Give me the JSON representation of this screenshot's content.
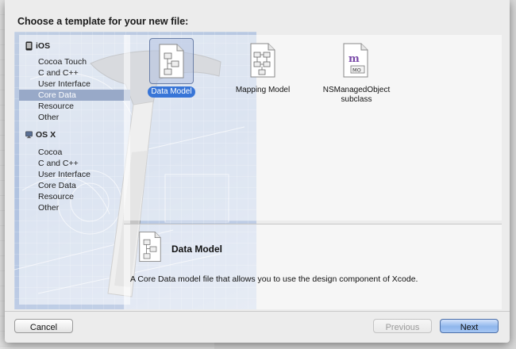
{
  "dialog": {
    "title": "Choose a template for your new file:"
  },
  "sidebar": {
    "sections": [
      {
        "name": "iOS",
        "icon": "iphone-icon",
        "items": [
          "Cocoa Touch",
          "C and C++",
          "User Interface",
          "Core Data",
          "Resource",
          "Other"
        ]
      },
      {
        "name": "OS X",
        "icon": "mac-icon",
        "items": [
          "Cocoa",
          "C and C++",
          "User Interface",
          "Core Data",
          "Resource",
          "Other"
        ]
      }
    ],
    "selected": "iOS / Core Data"
  },
  "templates": [
    {
      "label": "Data Model",
      "icon": "data-model-icon",
      "selected": true
    },
    {
      "label": "Mapping Model",
      "icon": "mapping-model-icon",
      "selected": false
    },
    {
      "label": "NSManagedObject subclass",
      "icon": "managed-object-icon",
      "selected": false
    }
  ],
  "detail": {
    "title": "Data Model",
    "description": "A Core Data model file that allows you to use the design component of Xcode."
  },
  "buttons": {
    "cancel": "Cancel",
    "previous": "Previous",
    "next": "Next"
  },
  "colors": {
    "selection_blue": "#3875d7",
    "sidebar_selection": "#98a9c8"
  }
}
